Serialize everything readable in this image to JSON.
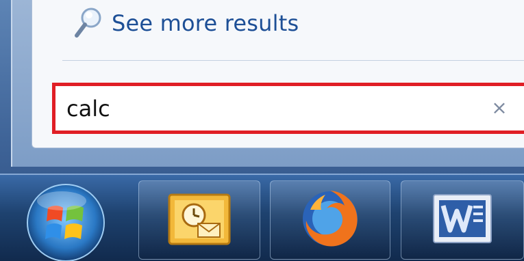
{
  "start_menu": {
    "see_more_label": "See more results",
    "search": {
      "value": "calc",
      "placeholder": "",
      "clear_glyph": "×"
    }
  },
  "taskbar": {
    "start_button": {
      "icon": "windows-start-orb-icon"
    },
    "pinned": [
      {
        "app": "Outlook",
        "icon": "outlook-icon"
      },
      {
        "app": "Firefox",
        "icon": "firefox-icon"
      },
      {
        "app": "Word",
        "icon": "word-icon"
      }
    ]
  },
  "colors": {
    "highlight": "#e01e25",
    "link": "#1d4f96",
    "taskbar": "#1e426f"
  }
}
